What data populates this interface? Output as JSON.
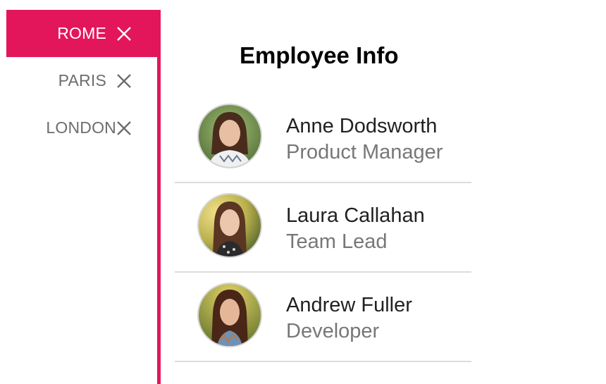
{
  "tabs": [
    {
      "label": "ROME",
      "active": true
    },
    {
      "label": "PARIS",
      "active": false
    },
    {
      "label": "LONDON",
      "active": false
    }
  ],
  "accent_color": "#e3165b",
  "panel": {
    "title": "Employee Info"
  },
  "employees": [
    {
      "name": "Anne Dodsworth",
      "role": "Product Manager",
      "avatar_icon": "person-photo"
    },
    {
      "name": "Laura Callahan",
      "role": "Team Lead",
      "avatar_icon": "person-photo"
    },
    {
      "name": "Andrew Fuller",
      "role": "Developer",
      "avatar_icon": "person-photo"
    }
  ]
}
